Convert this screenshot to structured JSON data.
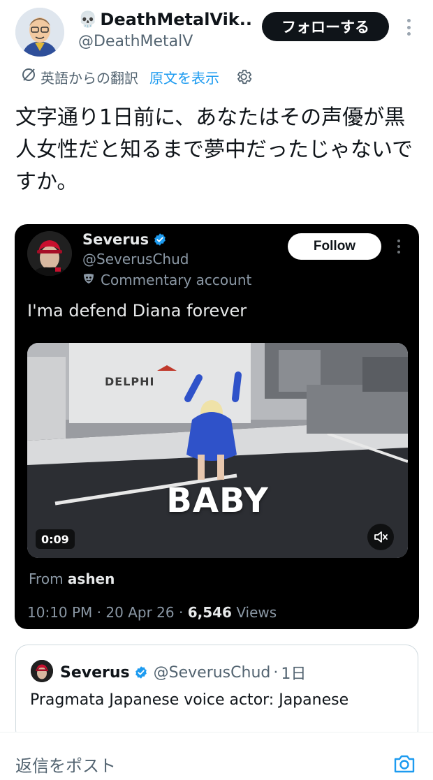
{
  "header": {
    "skull_emoji": "💀",
    "author_name": "DeathMetalVik...",
    "author_handle": "@DeathMetalV",
    "follow_label": "フォローする"
  },
  "translation": {
    "label": "英語からの翻訳",
    "show_original": "原文を表示"
  },
  "post": {
    "text": "文字通り1日前に、あなたはその声優が黒人女性だと知るまで夢中だったじゃないですか。"
  },
  "quoted": {
    "name": "Severus",
    "handle": "@SeverusChud",
    "label": "Commentary account",
    "follow_label": "Follow",
    "text": "I'ma defend Diana forever",
    "video": {
      "sign_text": "DELPHI",
      "overlay_text": "BABY",
      "duration": "0:09"
    },
    "from_prefix": "From",
    "from_name": "ashen",
    "time": "10:10 PM",
    "date": "20 Apr 26",
    "views_count": "6,546",
    "views_label": "Views",
    "separator": "·"
  },
  "nested_quote": {
    "name": "Severus",
    "handle": "@SeverusChud",
    "separator": "·",
    "time": "1日",
    "text": "Pragmata Japanese voice actor: Japanese"
  },
  "reply": {
    "placeholder": "返信をポスト"
  },
  "colors": {
    "link": "#1d9bf0",
    "verified": "#1d9bf0",
    "text_primary": "#0f1419",
    "text_secondary": "#536471"
  },
  "icons": [
    "skull-emoji",
    "translate-icon",
    "gear-icon",
    "verified-badge-icon",
    "mask-icon",
    "mute-icon",
    "camera-icon",
    "more-icon"
  ]
}
